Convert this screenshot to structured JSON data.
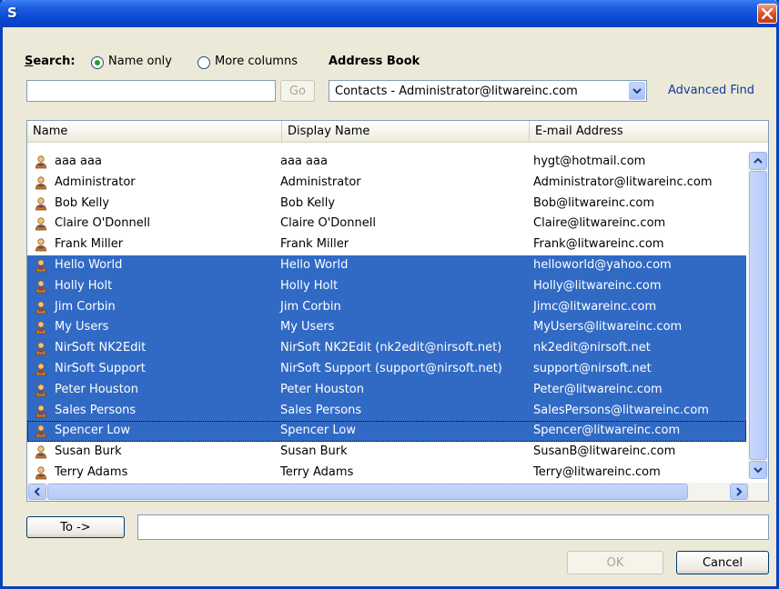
{
  "window": {
    "title": "S"
  },
  "search": {
    "label": "Search:",
    "radio_name_only": "Name only",
    "radio_more_columns": "More columns",
    "selected_mode": "Name only",
    "input_value": "",
    "go_label": "Go"
  },
  "address_book": {
    "label": "Address Book",
    "selected": "Contacts - Administrator@litwareinc.com",
    "advanced_find": "Advanced Find"
  },
  "list": {
    "columns": [
      "Name",
      "Display Name",
      "E-mail Address"
    ],
    "rows": [
      {
        "name": "aaa aaa",
        "display": "aaa aaa",
        "email": "hygt@hotmail.com",
        "selected": false
      },
      {
        "name": "Administrator",
        "display": "Administrator",
        "email": "Administrator@litwareinc.com",
        "selected": false
      },
      {
        "name": "Bob Kelly",
        "display": "Bob Kelly",
        "email": "Bob@litwareinc.com",
        "selected": false
      },
      {
        "name": "Claire O'Donnell",
        "display": "Claire O'Donnell",
        "email": "Claire@litwareinc.com",
        "selected": false
      },
      {
        "name": "Frank Miller",
        "display": "Frank Miller",
        "email": "Frank@litwareinc.com",
        "selected": false
      },
      {
        "name": "Hello World",
        "display": "Hello World",
        "email": "helloworld@yahoo.com",
        "selected": true
      },
      {
        "name": "Holly Holt",
        "display": "Holly Holt",
        "email": "Holly@litwareinc.com",
        "selected": true
      },
      {
        "name": "Jim Corbin",
        "display": "Jim Corbin",
        "email": "Jimc@litwareinc.com",
        "selected": true
      },
      {
        "name": "My Users",
        "display": "My Users",
        "email": "MyUsers@litwareinc.com",
        "selected": true
      },
      {
        "name": "NirSoft NK2Edit",
        "display": "NirSoft NK2Edit (nk2edit@nirsoft.net)",
        "email": "nk2edit@nirsoft.net",
        "selected": true
      },
      {
        "name": "NirSoft Support",
        "display": "NirSoft Support (support@nirsoft.net)",
        "email": "support@nirsoft.net",
        "selected": true
      },
      {
        "name": "Peter Houston",
        "display": "Peter Houston",
        "email": "Peter@litwareinc.com",
        "selected": true
      },
      {
        "name": "Sales Persons",
        "display": "Sales Persons",
        "email": "SalesPersons@litwareinc.com",
        "selected": true
      },
      {
        "name": "Spencer Low",
        "display": "Spencer Low",
        "email": "Spencer@litwareinc.com",
        "selected": true,
        "focused": true
      },
      {
        "name": "Susan Burk",
        "display": "Susan Burk",
        "email": "SusanB@litwareinc.com",
        "selected": false
      },
      {
        "name": "Terry Adams",
        "display": "Terry Adams",
        "email": "Terry@litwareinc.com",
        "selected": false
      }
    ]
  },
  "to": {
    "button": "To ->",
    "value": ""
  },
  "footer": {
    "ok": "OK",
    "cancel": "Cancel"
  },
  "icons": {
    "contact": "contact-person-icon",
    "close": "close-icon",
    "dropdown": "chevron-down-icon"
  },
  "colors": {
    "selection": "#316ac5",
    "titlebar": "#0a47d2",
    "dialog_bg": "#ece9d8"
  }
}
